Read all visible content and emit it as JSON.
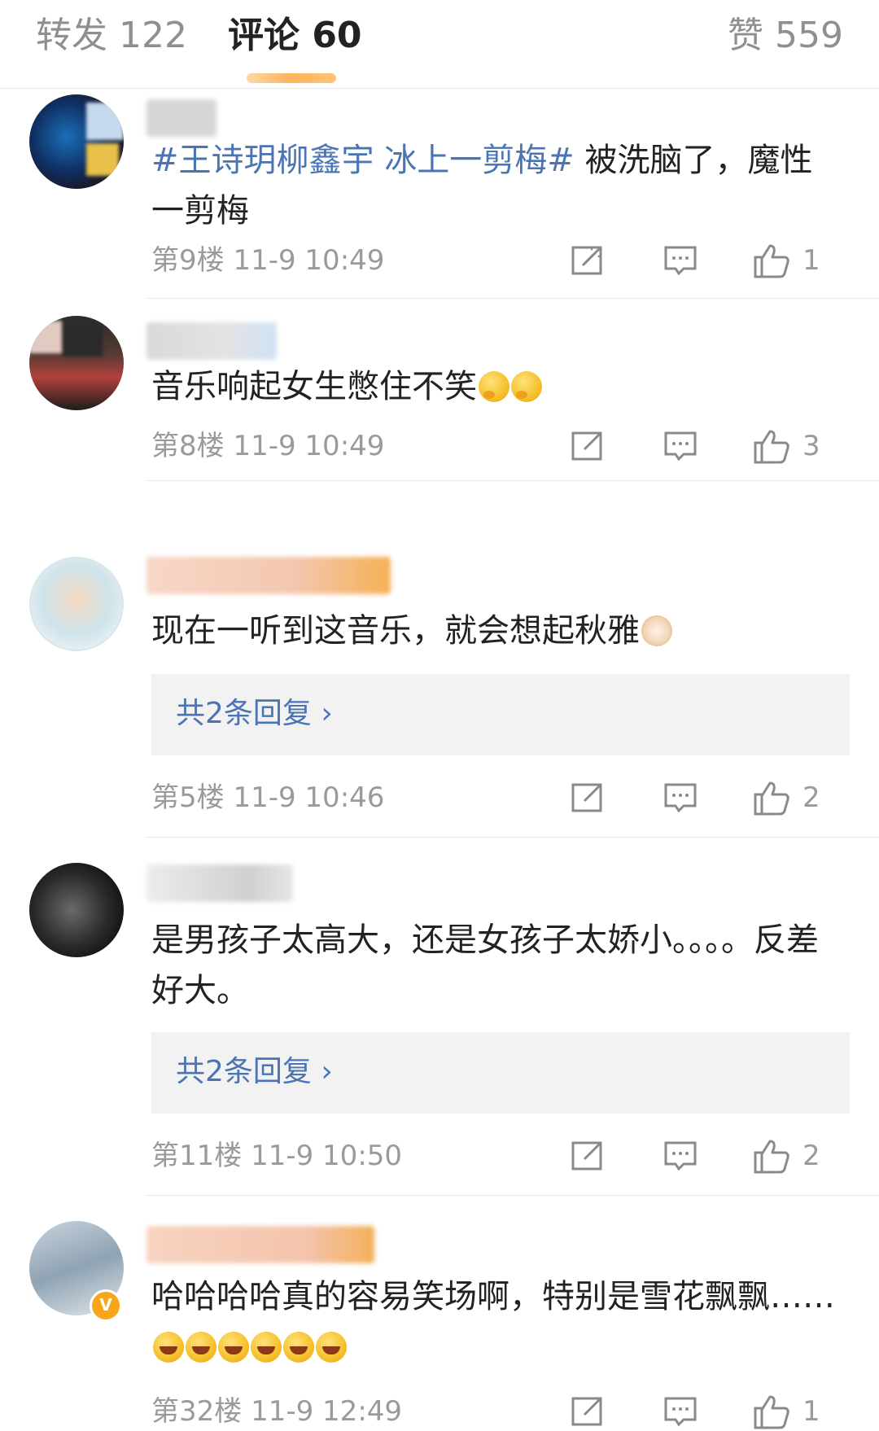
{
  "tabs": {
    "repost": "转发 122",
    "comments": "评论 60",
    "likes": "赞 559"
  },
  "comments": [
    {
      "topic": "#王诗玥柳鑫宇 冰上一剪梅#",
      "text": " 被洗脑了，魔性一剪梅",
      "floor": "第9楼",
      "time": "11-9 10:49",
      "likes": "1"
    },
    {
      "text": "音乐响起女生憋住不笑",
      "floor": "第8楼",
      "time": "11-9 10:49",
      "likes": "3"
    },
    {
      "text": "现在一听到这音乐，就会想起秋雅",
      "reply_link": "共2条回复 ›",
      "floor": "第5楼",
      "time": "11-9 10:46",
      "likes": "2"
    },
    {
      "text": "是男孩子太高大，还是女孩子太娇小。。。。反差好大。",
      "reply_link": "共2条回复 ›",
      "floor": "第11楼",
      "time": "11-9 10:50",
      "likes": "2"
    },
    {
      "text": "哈哈哈哈真的容易笑场啊，特别是雪花飘飘……",
      "floor": "第32楼",
      "time": "11-9 12:49",
      "likes": "1"
    }
  ],
  "icons": {
    "share": "share-icon",
    "reply": "comment-icon",
    "like": "thumbs-up-icon",
    "verified": "verified-badge-icon"
  },
  "colors": {
    "link": "#4a74b3",
    "meta": "#9a9a9a",
    "accent": "#ffb35a",
    "verified": "#f7a51b"
  },
  "verified_badge_text": "V"
}
